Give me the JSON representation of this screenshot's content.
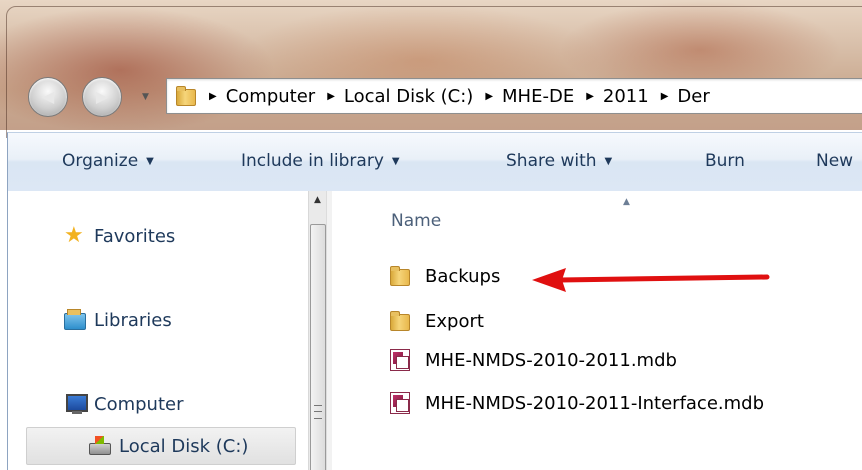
{
  "address_bar": {
    "crumbs": [
      "Computer",
      "Local Disk (C:)",
      "MHE-DE",
      "2011",
      "Der"
    ]
  },
  "toolbar": {
    "organize": "Organize",
    "include_in_library": "Include in library",
    "share_with": "Share with",
    "burn": "Burn",
    "new": "New"
  },
  "nav_pane": {
    "favorites": "Favorites",
    "libraries": "Libraries",
    "computer": "Computer",
    "local_disk": "Local Disk (C:)"
  },
  "file_list": {
    "column_name": "Name",
    "items": [
      {
        "name": "Backups",
        "icon": "folder-icon"
      },
      {
        "name": "Export",
        "icon": "folder-icon"
      },
      {
        "name": "MHE-NMDS-2010-2011.mdb",
        "icon": "access-db-icon"
      },
      {
        "name": "MHE-NMDS-2010-2011-Interface.mdb",
        "icon": "access-db-icon"
      }
    ]
  },
  "annotation": {
    "arrow_color": "#e01010",
    "points_to": "Backups"
  }
}
